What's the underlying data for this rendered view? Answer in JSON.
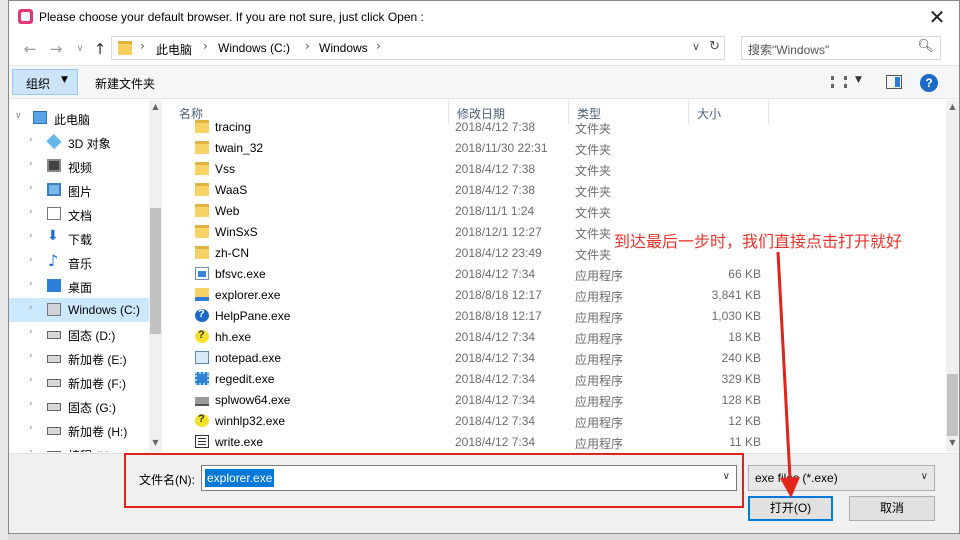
{
  "window": {
    "title": "Please choose your default browser. If you are not sure, just click Open :",
    "close_glyph": "✕"
  },
  "nav": {
    "back": "←",
    "forward": "→",
    "recent": "∨",
    "up": "↑",
    "breadcrumb": [
      "此电脑",
      "Windows (C:)",
      "Windows"
    ],
    "separator": "›",
    "refresh": "↻",
    "dropdown": "∨",
    "search_placeholder": "搜索\"Windows\"",
    "search_icon": "search-icon"
  },
  "toolbar": {
    "organize": "组织",
    "organize_dd": "▼",
    "new_folder": "新建文件夹",
    "view_dd": "▼",
    "help": "?"
  },
  "sidebar": {
    "items": [
      {
        "label": "此电脑",
        "icon": "computer-icon",
        "expander": "∨"
      },
      {
        "label": "3D 对象",
        "icon": "3d-objects-icon",
        "expander": "›"
      },
      {
        "label": "视频",
        "icon": "video-icon",
        "expander": "›"
      },
      {
        "label": "图片",
        "icon": "picture-icon",
        "expander": "›"
      },
      {
        "label": "文档",
        "icon": "document-icon",
        "expander": "›"
      },
      {
        "label": "下载",
        "icon": "download-icon",
        "expander": "›"
      },
      {
        "label": "音乐",
        "icon": "music-icon",
        "expander": "›"
      },
      {
        "label": "桌面",
        "icon": "desktop-icon",
        "expander": "›"
      },
      {
        "label": "Windows (C:)",
        "icon": "windows-drive-icon",
        "expander": "›"
      },
      {
        "label": "固态 (D:)",
        "icon": "drive-icon",
        "expander": "›"
      },
      {
        "label": "新加卷 (E:)",
        "icon": "drive-icon",
        "expander": "›"
      },
      {
        "label": "新加卷 (F:)",
        "icon": "drive-icon",
        "expander": "›"
      },
      {
        "label": "固态 (G:)",
        "icon": "drive-icon",
        "expander": "›"
      },
      {
        "label": "新加卷 (H:)",
        "icon": "drive-icon",
        "expander": "›"
      },
      {
        "label": "编程 (I:)",
        "icon": "drive-icon",
        "expander": "›"
      }
    ],
    "selected_index": 8,
    "scroll_up": "▲",
    "scroll_down": "▼"
  },
  "files": {
    "columns": [
      "名称",
      "修改日期",
      "类型",
      "大小"
    ],
    "sort_indicator": "˄",
    "rows": [
      {
        "name": "tracing",
        "date": "2018/4/12 7:38",
        "type": "文件夹",
        "size": "",
        "icon": "folder-icon"
      },
      {
        "name": "twain_32",
        "date": "2018/11/30 22:31",
        "type": "文件夹",
        "size": "",
        "icon": "folder-icon"
      },
      {
        "name": "Vss",
        "date": "2018/4/12 7:38",
        "type": "文件夹",
        "size": "",
        "icon": "folder-icon"
      },
      {
        "name": "WaaS",
        "date": "2018/4/12 7:38",
        "type": "文件夹",
        "size": "",
        "icon": "folder-icon"
      },
      {
        "name": "Web",
        "date": "2018/11/1 1:24",
        "type": "文件夹",
        "size": "",
        "icon": "folder-icon"
      },
      {
        "name": "WinSxS",
        "date": "2018/12/1 12:27",
        "type": "文件夹",
        "size": "",
        "icon": "folder-icon"
      },
      {
        "name": "zh-CN",
        "date": "2018/4/12 23:49",
        "type": "文件夹",
        "size": "",
        "icon": "folder-icon"
      },
      {
        "name": "bfsvc.exe",
        "date": "2018/4/12 7:34",
        "type": "应用程序",
        "size": "66 KB",
        "icon": "exe-icon"
      },
      {
        "name": "explorer.exe",
        "date": "2018/8/18 12:17",
        "type": "应用程序",
        "size": "3,841 KB",
        "icon": "explorer-icon"
      },
      {
        "name": "HelpPane.exe",
        "date": "2018/8/18 12:17",
        "type": "应用程序",
        "size": "1,030 KB",
        "icon": "help-icon"
      },
      {
        "name": "hh.exe",
        "date": "2018/4/12 7:34",
        "type": "应用程序",
        "size": "18 KB",
        "icon": "hh-help-icon"
      },
      {
        "name": "notepad.exe",
        "date": "2018/4/12 7:34",
        "type": "应用程序",
        "size": "240 KB",
        "icon": "notepad-icon"
      },
      {
        "name": "regedit.exe",
        "date": "2018/4/12 7:34",
        "type": "应用程序",
        "size": "329 KB",
        "icon": "regedit-icon"
      },
      {
        "name": "splwow64.exe",
        "date": "2018/4/12 7:34",
        "type": "应用程序",
        "size": "128 KB",
        "icon": "printer-icon"
      },
      {
        "name": "winhlp32.exe",
        "date": "2018/4/12 7:34",
        "type": "应用程序",
        "size": "12 KB",
        "icon": "hh-help-icon"
      },
      {
        "name": "write.exe",
        "date": "2018/4/12 7:34",
        "type": "应用程序",
        "size": "11 KB",
        "icon": "write-icon"
      }
    ],
    "scroll_up": "▲",
    "scroll_down": "▼"
  },
  "bottom": {
    "filename_label": "文件名(N):",
    "filename_value": "explorer.exe",
    "filename_dd": "∨",
    "filetype_value": "exe files (*.exe)",
    "filetype_dd": "∨",
    "open_label": "打开(O)",
    "cancel_label": "取消"
  },
  "annotation": {
    "note": "到达最后一步时，我们直接点击打开就好",
    "color": "#e0241b"
  }
}
